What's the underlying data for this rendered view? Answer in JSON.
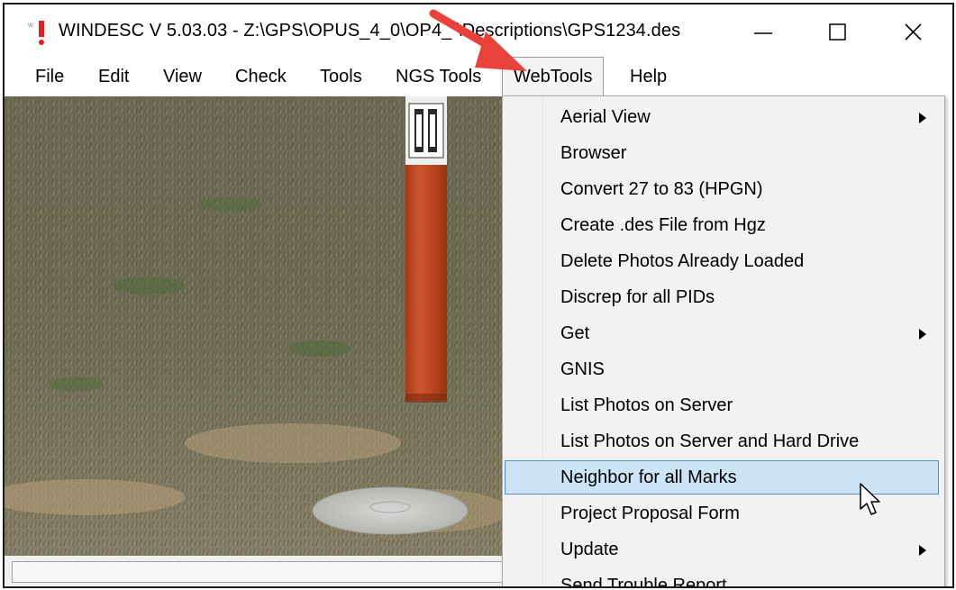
{
  "window": {
    "title": "WINDESC V 5.03.03 - Z:\\GPS\\OPUS_4_0\\OP4_ \\Descriptions\\GPS1234.des",
    "icon": "windesc-app-icon",
    "controls": [
      "minimize-icon",
      "maximize-icon",
      "close-icon"
    ]
  },
  "menubar": {
    "items": [
      "File",
      "Edit",
      "View",
      "Check",
      "Tools",
      "NGS Tools",
      "WebTools",
      "Help"
    ],
    "active": "WebTools"
  },
  "dropdown": {
    "items": [
      {
        "label": "Aerial View",
        "submenu": true
      },
      {
        "label": "Browser",
        "submenu": false
      },
      {
        "label": "Convert 27 to 83 (HPGN)",
        "submenu": false
      },
      {
        "label": "Create .des File from Hgz",
        "submenu": false
      },
      {
        "label": "Delete Photos Already Loaded",
        "submenu": false
      },
      {
        "label": "Discrep for all PIDs",
        "submenu": false
      },
      {
        "label": "Get",
        "submenu": true
      },
      {
        "label": "GNIS",
        "submenu": false
      },
      {
        "label": "List Photos on Server",
        "submenu": false
      },
      {
        "label": "List Photos on Server and Hard Drive",
        "submenu": false
      },
      {
        "label": "Neighbor for all Marks",
        "submenu": false,
        "highlighted": true
      },
      {
        "label": "Project Proposal Form",
        "submenu": false
      },
      {
        "label": "Update",
        "submenu": true
      },
      {
        "label": "Send Trouble Report",
        "submenu": false
      }
    ]
  },
  "statusbar": {
    "text": ""
  },
  "colors": {
    "highlight_fill": "#cde4f7",
    "highlight_border": "#4d93d9",
    "annotation_arrow": "#e8423a",
    "post_orange": "#c8491e"
  }
}
